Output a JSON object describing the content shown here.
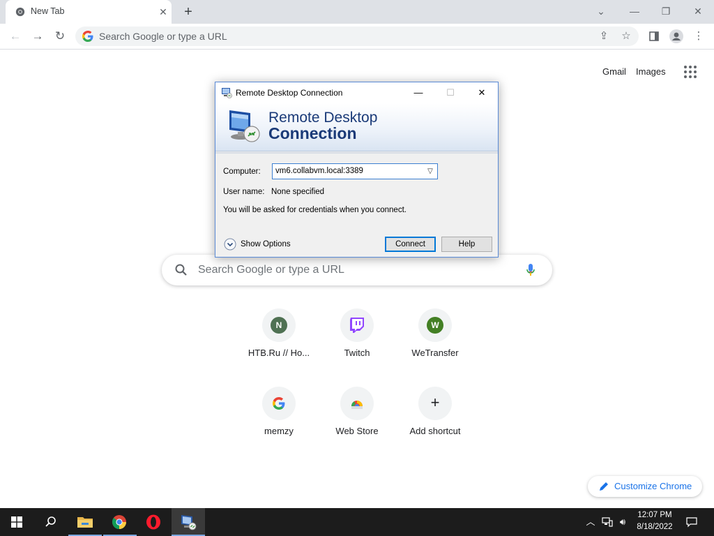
{
  "browser": {
    "tab_title": "New Tab",
    "omnibox_placeholder": "Search Google or type a URL"
  },
  "ntp": {
    "gmail": "Gmail",
    "images": "Images",
    "search_placeholder": "Search Google or type a URL",
    "shortcuts": [
      {
        "label": "HTB.Ru // Ho...",
        "letter": "N",
        "color": "#4f7153"
      },
      {
        "label": "Twitch",
        "letter": "",
        "color": "#9146ff"
      },
      {
        "label": "WeTransfer",
        "letter": "W",
        "color": "#437f24"
      },
      {
        "label": "memzy",
        "letter": "G",
        "color": "#4285f4"
      },
      {
        "label": "Web Store",
        "letter": "",
        "color": "#ea4335"
      },
      {
        "label": "Add shortcut",
        "letter": "+",
        "color": "#202124"
      }
    ],
    "customize_label": "Customize Chrome"
  },
  "rdp": {
    "window_title": "Remote Desktop Connection",
    "banner_line1": "Remote Desktop",
    "banner_line2": "Connection",
    "computer_label": "Computer:",
    "computer_value": "vm6.collabvm.local:3389",
    "user_label": "User name:",
    "user_value": "None specified",
    "note": "You will be asked for credentials when you connect.",
    "show_options": "Show Options",
    "connect_button": "Connect",
    "help_button": "Help"
  },
  "taskbar": {
    "time": "12:07 PM",
    "date": "8/18/2022"
  },
  "colors": {
    "accent_blue": "#1a73e8",
    "taskbar": "#1c1c1c",
    "rdp_title_blue": "#1a3a78"
  }
}
